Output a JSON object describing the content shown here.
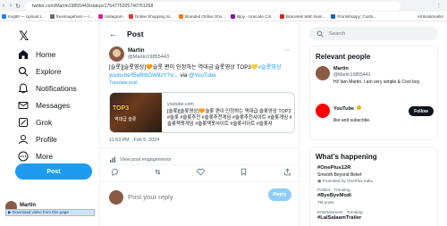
{
  "browser": {
    "url": "twitter.com/Martin19855443/status/1754775205740761258",
    "bookmarks": [
      {
        "label": "Img88 — Upload I...",
        "color": "#2b7de9"
      },
      {
        "label": "freeimagehost — I...",
        "color": "#6c6c6c"
      },
      {
        "label": "Instagram",
        "color": "#d6249f"
      },
      {
        "label": "Online Shopping Si...",
        "color": "#e53935"
      },
      {
        "label": "Branded Online Sho...",
        "color": "#f57c00"
      },
      {
        "label": "Bjoy - Unicode Col...",
        "color": "#7b1fa2"
      },
      {
        "label": "Bracelets With Nam...",
        "color": "#c62828"
      },
      {
        "label": "Frontshoppy: Custo...",
        "color": "#1565c0"
      }
    ],
    "all_bookmarks_label": "All Bookmarks"
  },
  "sidebar": {
    "logo": "𝕏",
    "items": [
      {
        "label": "Home",
        "icon": "home-icon"
      },
      {
        "label": "Explore",
        "icon": "search-icon"
      },
      {
        "label": "Notifications",
        "icon": "bell-icon"
      },
      {
        "label": "Messages",
        "icon": "envelope-icon"
      },
      {
        "label": "Grok",
        "icon": "grok-icon"
      },
      {
        "label": "Profile",
        "icon": "person-icon"
      },
      {
        "label": "More",
        "icon": "more-circle-icon"
      }
    ],
    "post_button": "Post",
    "account_name": "Martin",
    "download_bar": "Download video from this page"
  },
  "main": {
    "header_title": "Post",
    "author_name": "Martin",
    "author_handle": "@Martin19855443",
    "tweet_text": "[슬롯][슬롯영상]🧡슬롯 편이 인정하는 역대급 슬롯영상 TOP3💛",
    "tweet_hashtag": "#슬롯영상",
    "tweet_link": "youtu.be/f5eBIbGW8zY?si...",
    "tweet_via": " via ",
    "tweet_via_link": "@YouTube",
    "translate_label": "Translate post",
    "card_domain": "youtube.com",
    "card_title": "[슬롯][슬롯영상]🧡슬롯 편이 인정하는 역대급 슬롯영상 TOP3 #슬롯 #슬롯추천 #슬롯추천게임 #슬롯추천사이트 #슬롯게임 #슬롯잭팟게임 #슬롯잭팟사이트 #슬롯사이트 #슬롯사",
    "card_thumb_text": "TOP3",
    "card_thumb_sub": "역대급 슬롯",
    "timestamp": "11:53 PM · Feb 5, 2024",
    "view_engagements": "View post engagements",
    "reply_placeholder": "Post your reply",
    "reply_button": "Reply"
  },
  "right": {
    "search_placeholder": "Search",
    "relevant_title": "Relevant people",
    "people": [
      {
        "name": "Martin",
        "handle": "@Martin19855443",
        "bio": "Hi! Iam Martin, I am very simple & Cool boy.",
        "color": "#8a5a44"
      },
      {
        "name": "YouTube",
        "handle": "",
        "bio": "like and subscribe.",
        "color": "#ff0000",
        "follow": "Follow"
      }
    ],
    "happening_title": "What’s happening",
    "trends": [
      {
        "tag": "#OnePlus12R",
        "desc": "Smooth Beyond Belief",
        "promo": "Promoted by OnePlus India"
      },
      {
        "small": "Politics · Trending",
        "tag": "#ByeByeModi",
        "desc": "7M posts"
      },
      {
        "small": "Entertainment · Trending",
        "tag": "#LalSalaamTrailer"
      }
    ]
  }
}
